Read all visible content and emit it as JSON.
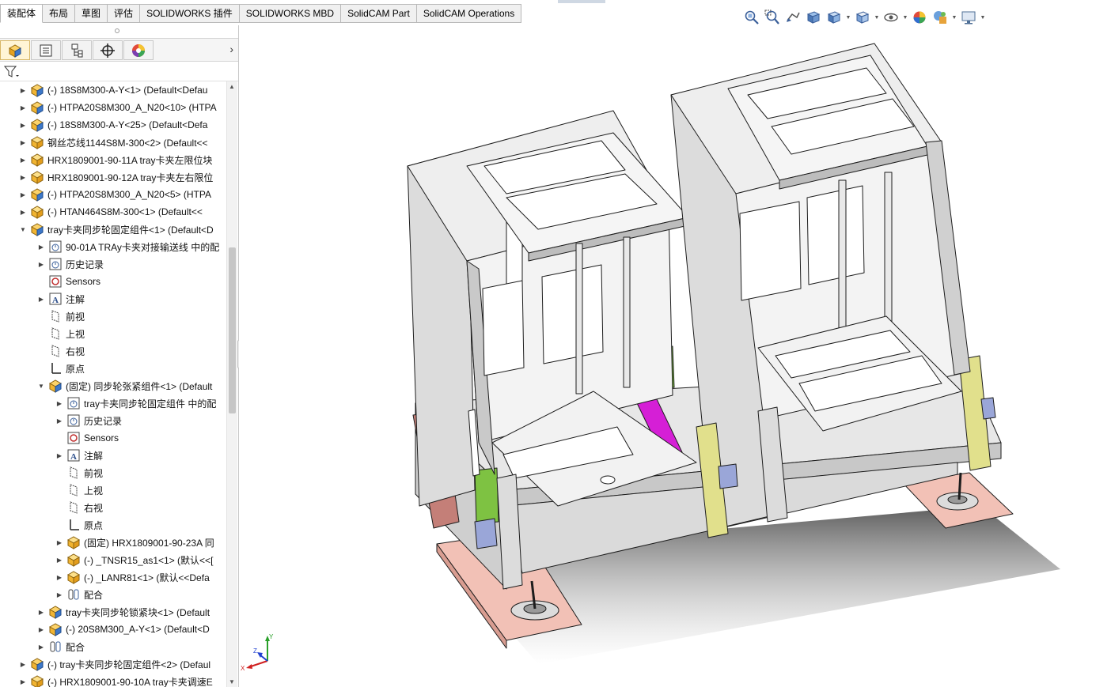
{
  "command_manager": {
    "tabs": [
      {
        "label": "装配体",
        "active": true
      },
      {
        "label": "布局"
      },
      {
        "label": "草图"
      },
      {
        "label": "评估"
      },
      {
        "label": "SOLIDWORKS 插件"
      },
      {
        "label": "SOLIDWORKS MBD"
      },
      {
        "label": "SolidCAM Part"
      },
      {
        "label": "SolidCAM Operations"
      }
    ]
  },
  "heads_up_toolbar": {
    "icons": [
      "zoom-to-fit-icon",
      "zoom-to-area-icon",
      "previous-view-icon",
      "section-view-icon",
      "view-orientation-icon",
      "display-style-icon",
      "hide-show-items-icon",
      "edit-appearance-icon",
      "apply-scene-icon",
      "view-settings-icon"
    ]
  },
  "feature_manager": {
    "panel_tabs": [
      "feature-manager-icon",
      "property-manager-icon",
      "configuration-manager-icon",
      "dimxpert-manager-icon",
      "display-manager-icon"
    ],
    "tree": [
      {
        "label": "(-) 18S8M300-A-Y<1> (Default<Defau",
        "icon": "assembly",
        "indent": 0,
        "arrow": "right"
      },
      {
        "label": "(-) HTPA20S8M300_A_N20<10> (HTPA",
        "icon": "assembly",
        "indent": 0,
        "arrow": "right"
      },
      {
        "label": "(-) 18S8M300-A-Y<25> (Default<Defa",
        "icon": "assembly",
        "indent": 0,
        "arrow": "right"
      },
      {
        "label": "钢丝芯线1144S8M-300<2> (Default<<",
        "icon": "part",
        "indent": 0,
        "arrow": "right"
      },
      {
        "label": "HRX1809001-90-11A tray卡夹左限位块",
        "icon": "part",
        "indent": 0,
        "arrow": "right"
      },
      {
        "label": "HRX1809001-90-12A tray卡夹左右限位",
        "icon": "part",
        "indent": 0,
        "arrow": "right"
      },
      {
        "label": "(-) HTPA20S8M300_A_N20<5> (HTPA",
        "icon": "assembly",
        "indent": 0,
        "arrow": "right"
      },
      {
        "label": "(-) HTAN464S8M-300<1> (Default<<",
        "icon": "part",
        "indent": 0,
        "arrow": "right"
      },
      {
        "label": "tray卡夹同步轮固定组件<1> (Default<D",
        "icon": "assembly",
        "indent": 0,
        "arrow": "down"
      },
      {
        "label": "90-01A TRAy卡夹对接输送线 中的配",
        "icon": "history",
        "indent": 1,
        "arrow": "right"
      },
      {
        "label": "历史记录",
        "icon": "history",
        "indent": 1,
        "arrow": "right"
      },
      {
        "label": "Sensors",
        "icon": "sensor",
        "indent": 1,
        "arrow": ""
      },
      {
        "label": "注解",
        "icon": "annotation",
        "indent": 1,
        "arrow": "right"
      },
      {
        "label": "前视",
        "icon": "plane",
        "indent": 1,
        "arrow": ""
      },
      {
        "label": "上视",
        "icon": "plane",
        "indent": 1,
        "arrow": ""
      },
      {
        "label": "右视",
        "icon": "plane",
        "indent": 1,
        "arrow": ""
      },
      {
        "label": "原点",
        "icon": "origin",
        "indent": 1,
        "arrow": ""
      },
      {
        "label": "(固定) 同步轮张紧组件<1> (Default",
        "icon": "assembly",
        "indent": 1,
        "arrow": "down"
      },
      {
        "label": "tray卡夹同步轮固定组件 中的配",
        "icon": "history",
        "indent": 2,
        "arrow": "right"
      },
      {
        "label": "历史记录",
        "icon": "history",
        "indent": 2,
        "arrow": "right"
      },
      {
        "label": "Sensors",
        "icon": "sensor",
        "indent": 2,
        "arrow": ""
      },
      {
        "label": "注解",
        "icon": "annotation",
        "indent": 2,
        "arrow": "right"
      },
      {
        "label": "前视",
        "icon": "plane",
        "indent": 2,
        "arrow": ""
      },
      {
        "label": "上视",
        "icon": "plane",
        "indent": 2,
        "arrow": ""
      },
      {
        "label": "右视",
        "icon": "plane",
        "indent": 2,
        "arrow": ""
      },
      {
        "label": "原点",
        "icon": "origin",
        "indent": 2,
        "arrow": ""
      },
      {
        "label": "(固定) HRX1809001-90-23A 同",
        "icon": "part",
        "indent": 2,
        "arrow": "right"
      },
      {
        "label": "(-) _TNSR15_as1<1> (默认<<[",
        "icon": "part",
        "indent": 2,
        "arrow": "right"
      },
      {
        "label": "(-) _LANR81<1> (默认<<Defa",
        "icon": "part",
        "indent": 2,
        "arrow": "right"
      },
      {
        "label": "配合",
        "icon": "mates",
        "indent": 2,
        "arrow": "right"
      },
      {
        "label": "tray卡夹同步轮锁紧块<1> (Default",
        "icon": "assembly",
        "indent": 1,
        "arrow": "right"
      },
      {
        "label": "(-) 20S8M300_A-Y<1> (Default<D",
        "icon": "assembly",
        "indent": 1,
        "arrow": "right"
      },
      {
        "label": "配合",
        "icon": "mates",
        "indent": 1,
        "arrow": "right"
      },
      {
        "label": "(-) tray卡夹同步轮固定组件<2> (Defaul",
        "icon": "assembly",
        "indent": 0,
        "arrow": "right"
      },
      {
        "label": "(-) HRX1809001-90-10A tray卡夹调速E",
        "icon": "part",
        "indent": 0,
        "arrow": "right"
      }
    ]
  },
  "triad": {
    "x_label": "X",
    "y_label": "Y",
    "z_label": "Z"
  },
  "colors": {
    "assembly_icon": "#f1b431",
    "part_icon": "#f1b431",
    "green_bracket": "#7ec242",
    "magenta_part": "#d51fd6",
    "yellow_bar": "#e1e08c",
    "salmon_base": "#f2c1b6",
    "selection_tab": "#fff5d6"
  }
}
